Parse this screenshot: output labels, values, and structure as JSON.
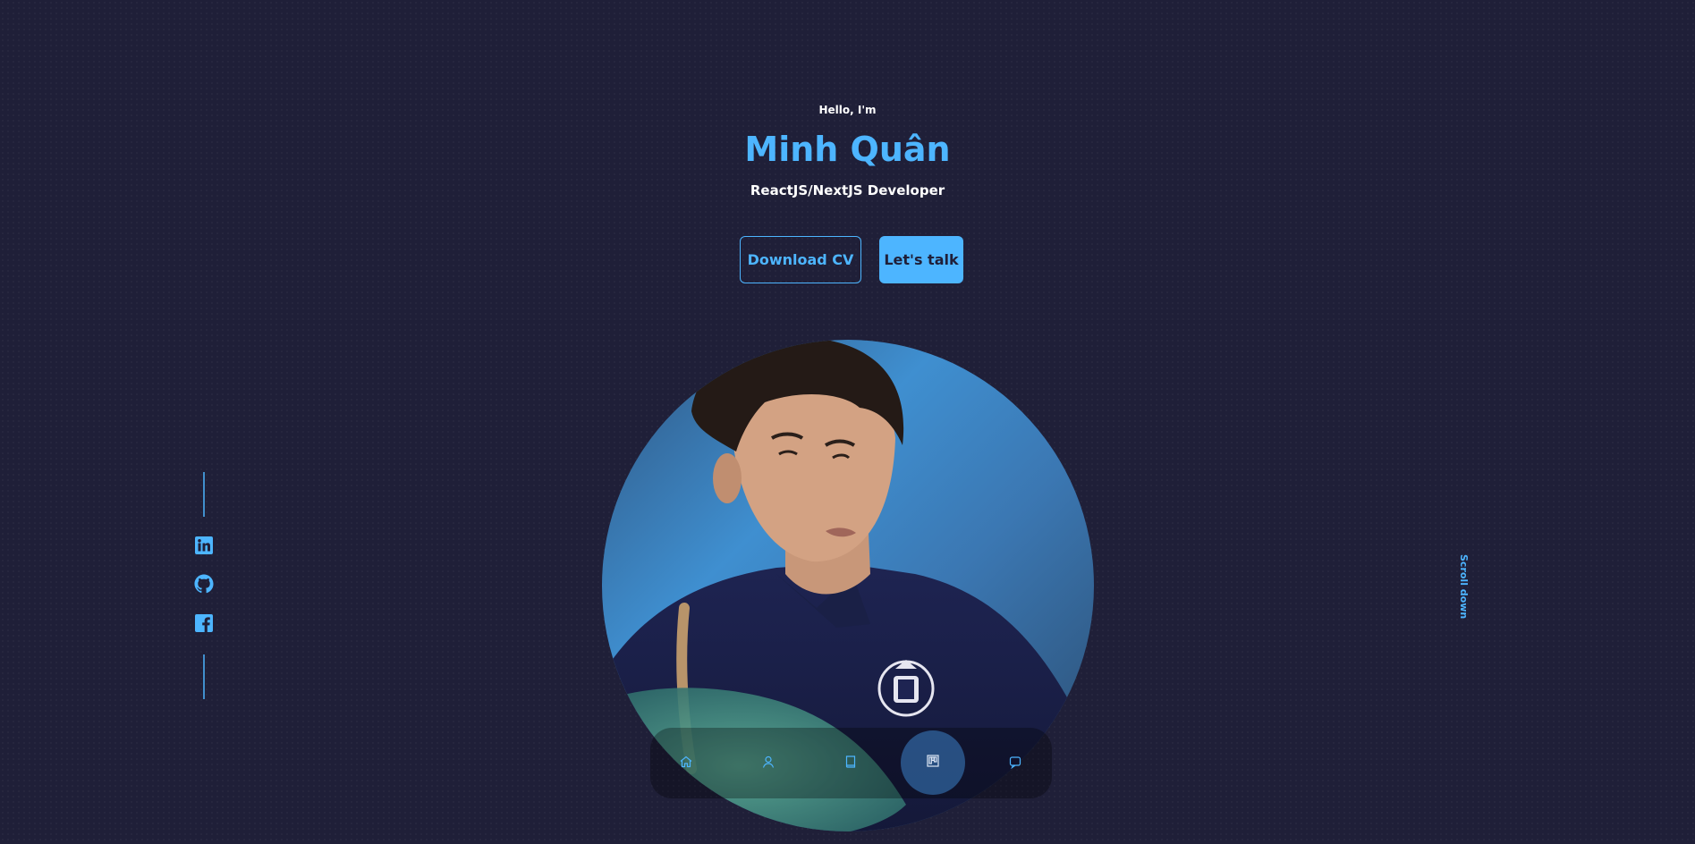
{
  "hero": {
    "greeting": "Hello, I'm",
    "name": "Minh Quân",
    "role": "ReactJS/NextJS Developer",
    "buttons": {
      "download_cv": "Download CV",
      "lets_talk": "Let's talk"
    },
    "scroll_down": "Scroll down"
  },
  "socials": [
    {
      "icon": "linkedin-icon"
    },
    {
      "icon": "github-icon"
    },
    {
      "icon": "facebook-icon"
    }
  ],
  "nav": {
    "items": [
      {
        "icon": "home-icon",
        "active": false
      },
      {
        "icon": "user-icon",
        "active": false
      },
      {
        "icon": "book-icon",
        "active": false
      },
      {
        "icon": "portfolio-icon",
        "active": true
      },
      {
        "icon": "message-icon",
        "active": false
      }
    ]
  },
  "colors": {
    "background": "#1f1f38",
    "accent": "#4db5ff",
    "text": "#ffffff"
  }
}
